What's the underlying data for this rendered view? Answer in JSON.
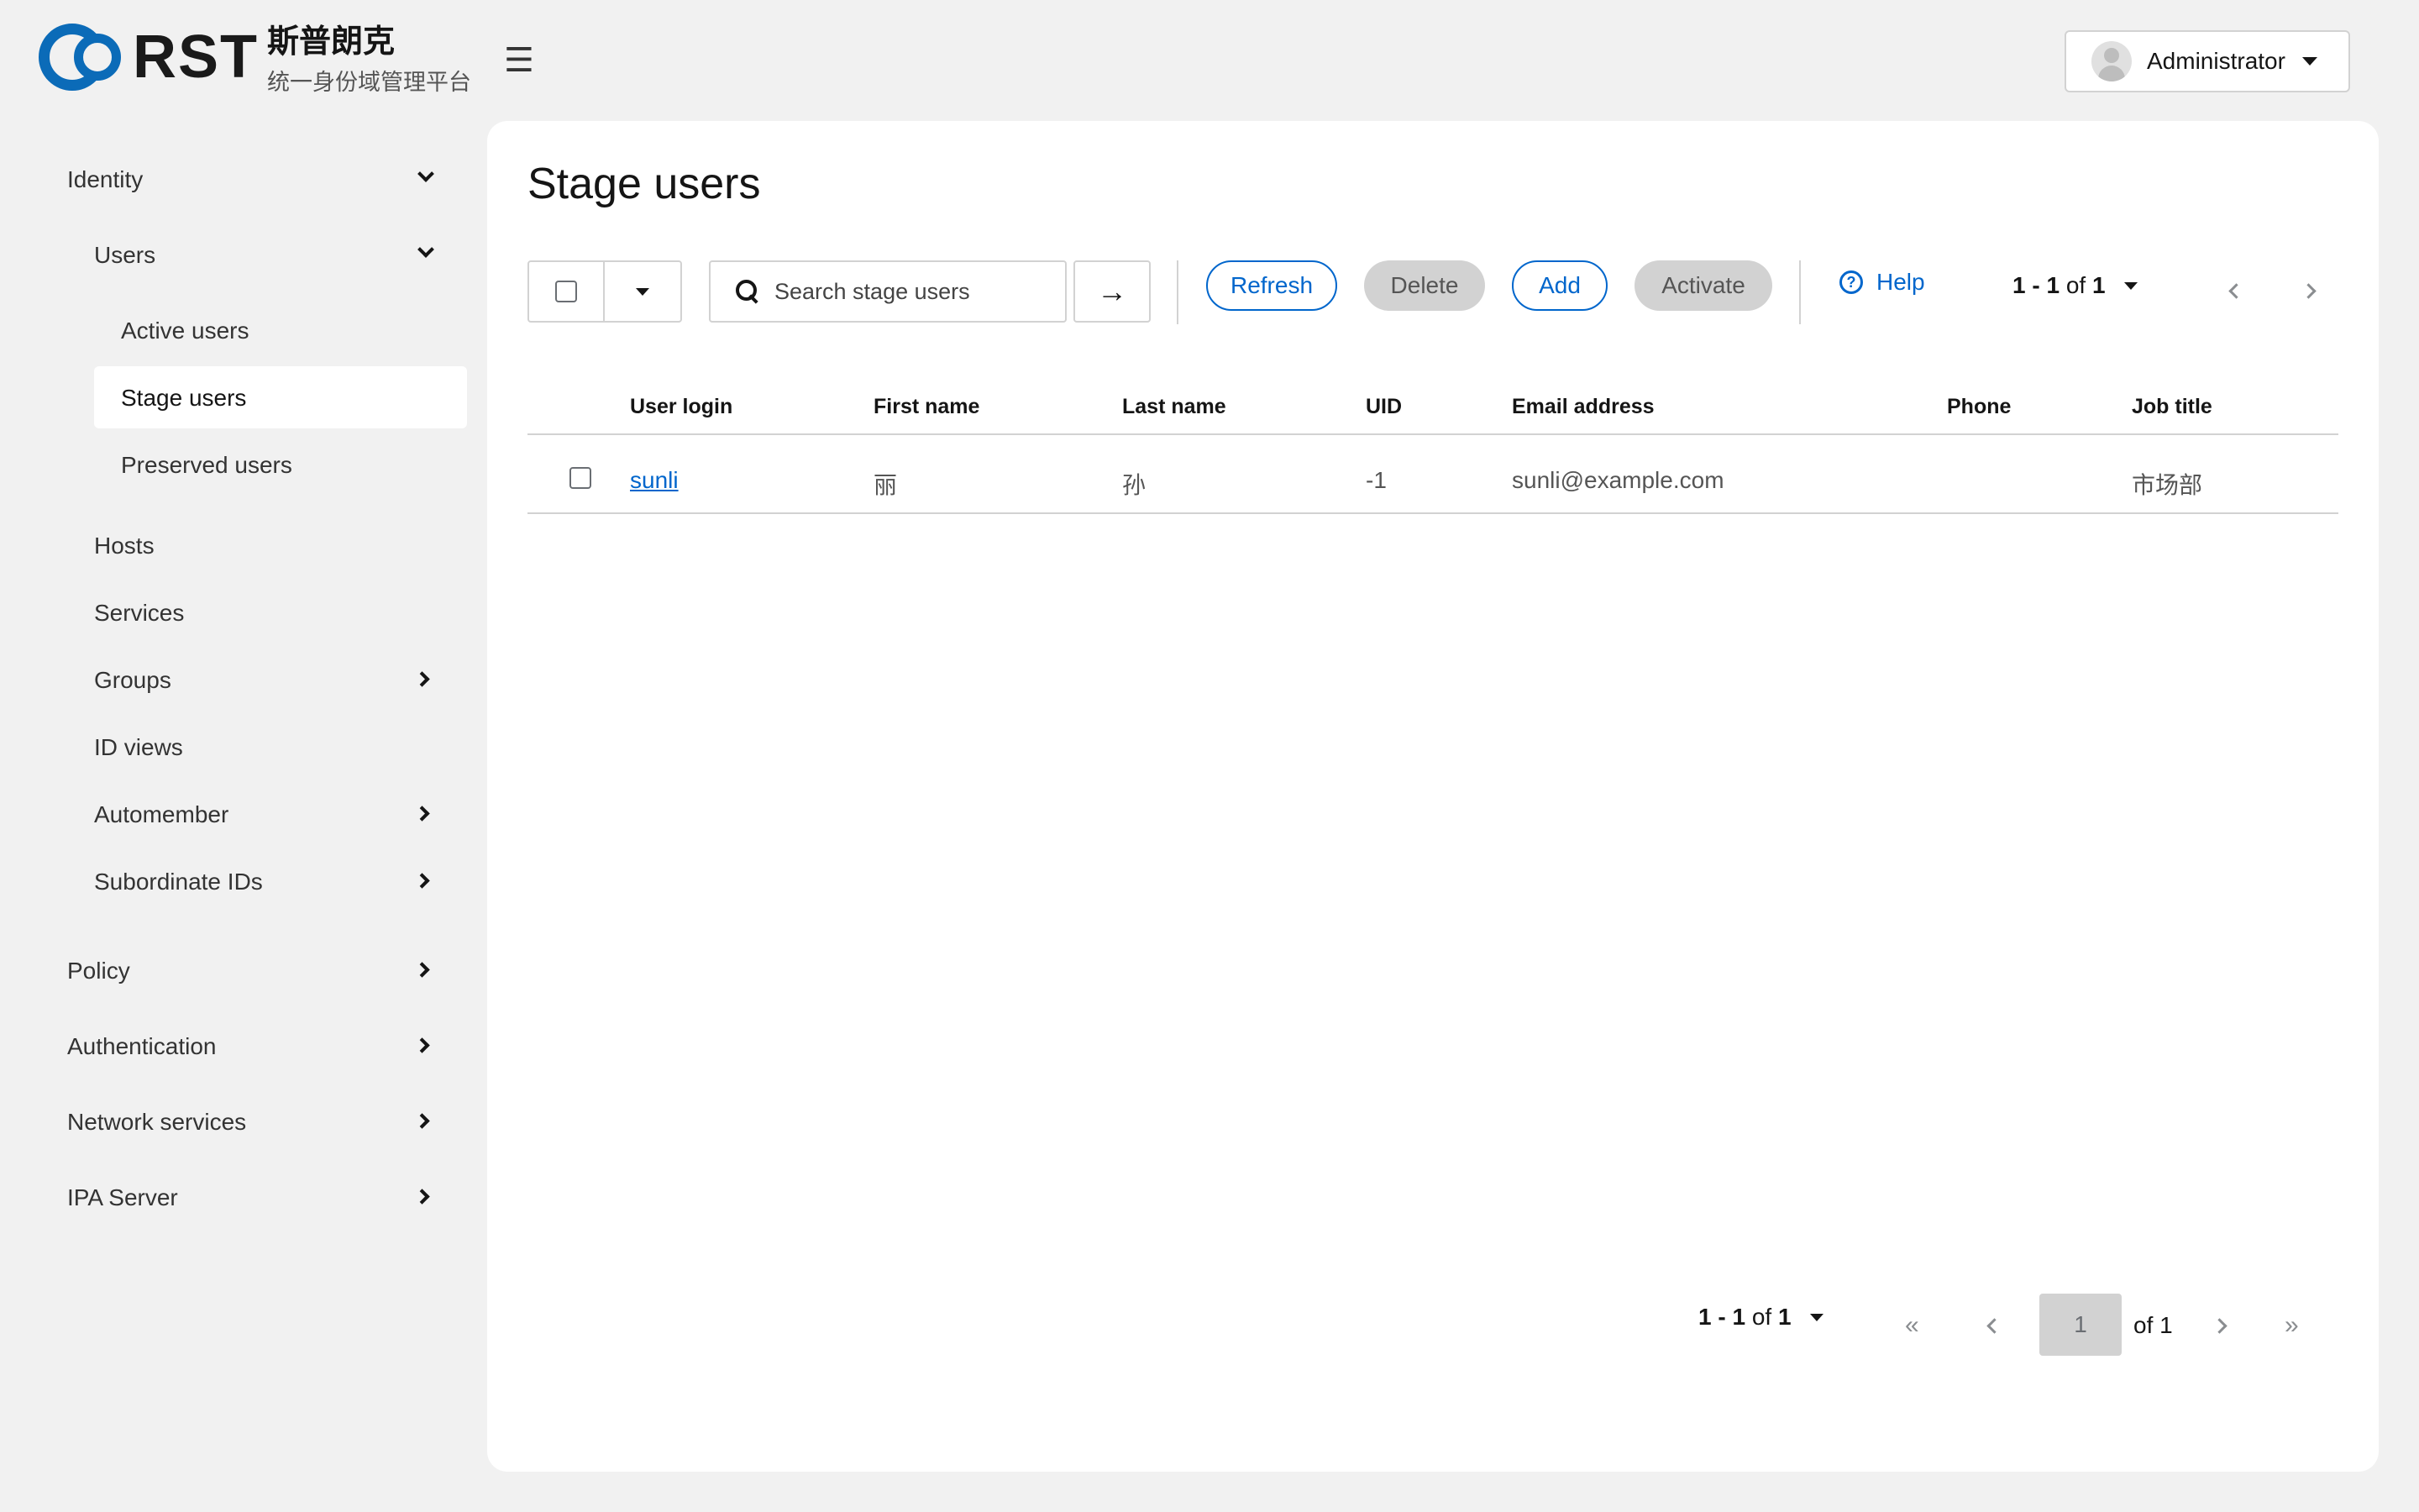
{
  "brand": {
    "logo_text": "RST",
    "name_cn": "斯普朗克",
    "subtitle": "统一身份域管理平台"
  },
  "header": {
    "user_name": "Administrator"
  },
  "sidebar": {
    "identity": "Identity",
    "users": "Users",
    "active_users": "Active users",
    "stage_users": "Stage users",
    "preserved_users": "Preserved users",
    "hosts": "Hosts",
    "services": "Services",
    "groups": "Groups",
    "id_views": "ID views",
    "automember": "Automember",
    "subordinate_ids": "Subordinate IDs",
    "policy": "Policy",
    "authentication": "Authentication",
    "network_services": "Network services",
    "ipa_server": "IPA Server"
  },
  "main": {
    "title": "Stage users",
    "search_placeholder": "Search stage users",
    "buttons": {
      "refresh": "Refresh",
      "delete": "Delete",
      "add": "Add",
      "activate": "Activate",
      "help": "Help"
    },
    "pager": {
      "range_start": "1",
      "range_sep": " - ",
      "range_end": "1",
      "of": " of ",
      "total": "1",
      "current_page": "1",
      "of_pages": "of 1"
    },
    "table": {
      "columns": [
        "User login",
        "First name",
        "Last name",
        "UID",
        "Email address",
        "Phone",
        "Job title"
      ],
      "rows": [
        {
          "user_login": "sunli",
          "first_name": "丽",
          "last_name": "孙",
          "uid": "-1",
          "email": "sunli@example.com",
          "phone": "",
          "job_title": "市场部"
        }
      ]
    }
  },
  "colors": {
    "accent": "#0066cc",
    "brand": "#0b6bb8",
    "background": "#f1f1f1",
    "disabled": "#d2d2d2"
  },
  "icons": {
    "menu": "hamburger-icon",
    "search": "search-icon",
    "go": "arrow-right-icon",
    "help": "question-circle-icon",
    "user": "avatar-icon"
  }
}
